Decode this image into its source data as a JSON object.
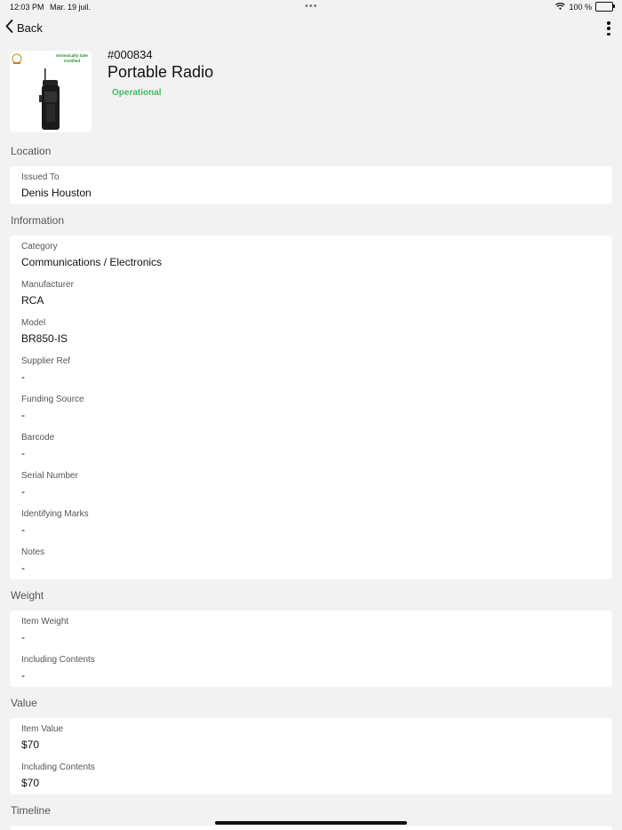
{
  "status_bar": {
    "time": "12:03 PM",
    "date": "Mar. 19 juil.",
    "multitask": "•••",
    "battery": "100 %"
  },
  "nav": {
    "back_label": "Back"
  },
  "asset": {
    "id": "#000834",
    "name": "Portable Radio",
    "status": "Operational",
    "status_color": "#3fbf63",
    "image_caption": "Intrinsically Safe Certified"
  },
  "sections": {
    "location": {
      "title": "Location",
      "fields": [
        {
          "label": "Issued To",
          "value": "Denis Houston"
        }
      ]
    },
    "information": {
      "title": "Information",
      "fields": [
        {
          "label": "Category",
          "value": "Communications / Electronics"
        },
        {
          "label": "Manufacturer",
          "value": "RCA"
        },
        {
          "label": "Model",
          "value": "BR850-IS"
        },
        {
          "label": "Supplier Ref",
          "value": "-"
        },
        {
          "label": "Funding Source",
          "value": "-"
        },
        {
          "label": "Barcode",
          "value": "-"
        },
        {
          "label": "Serial Number",
          "value": "-"
        },
        {
          "label": "Identifying Marks",
          "value": "-"
        },
        {
          "label": "Notes",
          "value": "-"
        }
      ]
    },
    "weight": {
      "title": "Weight",
      "fields": [
        {
          "label": "Item Weight",
          "value": "-"
        },
        {
          "label": "Including Contents",
          "value": "-"
        }
      ]
    },
    "value": {
      "title": "Value",
      "fields": [
        {
          "label": "Item Value",
          "value": "$70"
        },
        {
          "label": "Including Contents",
          "value": "$70"
        }
      ]
    },
    "timeline": {
      "title": "Timeline"
    }
  }
}
